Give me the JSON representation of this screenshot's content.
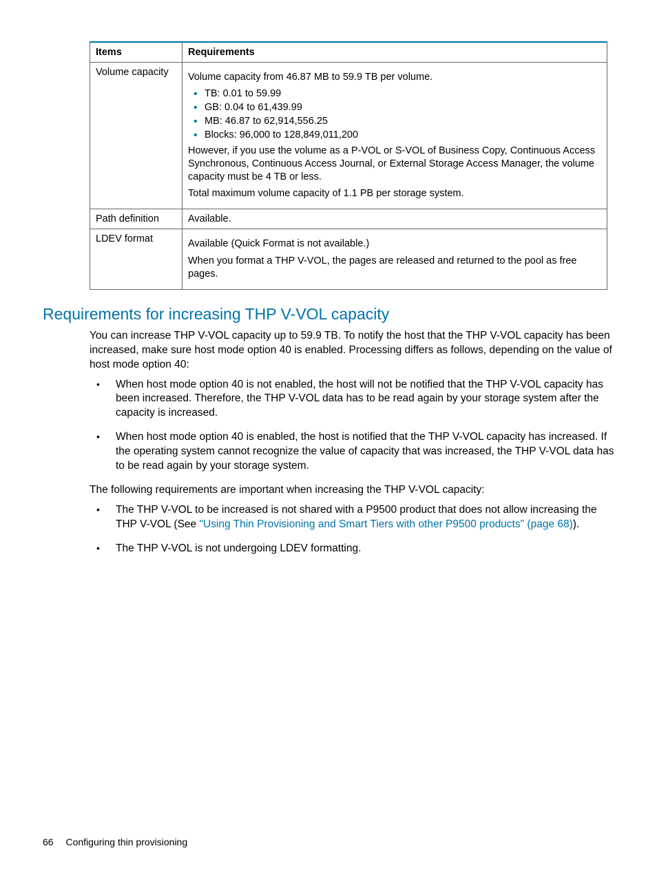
{
  "table": {
    "head": {
      "items": "Items",
      "req": "Requirements"
    },
    "rows": [
      {
        "item": "Volume capacity",
        "p1": "Volume capacity from 46.87 MB to 59.9 TB per volume.",
        "bullets": [
          "TB: 0.01 to 59.99",
          "GB: 0.04 to 61,439.99",
          "MB: 46.87 to 62,914,556.25",
          "Blocks: 96,000 to 128,849,011,200"
        ],
        "p2": "However, if you use the volume as a P-VOL or S-VOL of Business Copy, Continuous Access Synchronous, Continuous Access Journal, or External Storage Access Manager, the volume capacity must be 4 TB or less.",
        "p3": "Total maximum volume capacity of 1.1 PB per storage system."
      },
      {
        "item": "Path definition",
        "p1": "Available."
      },
      {
        "item": "LDEV format",
        "p1": "Available (Quick Format is not available.)",
        "p2": "When you format a THP V-VOL, the pages are released and returned to the pool as free pages."
      }
    ]
  },
  "section_heading": "Requirements for increasing THP V-VOL capacity",
  "para1": "You can increase THP V-VOL capacity up to 59.9 TB. To notify the host that the THP V-VOL capacity has been increased, make sure host mode option 40 is enabled. Processing differs as follows, depending on the value of host mode option 40:",
  "list1": [
    "When host mode option 40 is not enabled, the host will not be notified that the THP V-VOL capacity has been increased. Therefore, the THP V-VOL data has to be read again by your storage system after the capacity is increased.",
    "When host mode option 40 is enabled, the host is notified that the THP V-VOL capacity has increased. If the operating system cannot recognize the value of capacity that was increased, the THP V-VOL data has to be read again by your storage system."
  ],
  "para2": "The following requirements are important when increasing the THP V-VOL capacity:",
  "list2": {
    "item1_pre": "The THP V-VOL to be increased is not shared with a P9500 product that does not allow increasing the THP V-VOL (See ",
    "item1_link": "\"Using Thin Provisioning and Smart Tiers with other P9500 products\" (page 68)",
    "item1_post": ").",
    "item2": "The THP V-VOL is not undergoing LDEV formatting."
  },
  "footer": {
    "page": "66",
    "title": "Configuring thin provisioning"
  }
}
